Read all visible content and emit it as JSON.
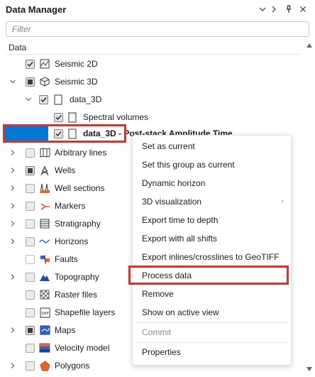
{
  "header": {
    "title": "Data Manager",
    "buttons": [
      "chevron-down-icon",
      "chevron-right-icon",
      "pin-icon",
      "close-icon"
    ]
  },
  "filter": {
    "placeholder": "Filter",
    "value": ""
  },
  "column_header": "Data",
  "tree": {
    "seismic_2d": {
      "label": "Seismic 2D",
      "checked": true
    },
    "seismic_3d": {
      "label": "Seismic 3D",
      "state": "partial"
    },
    "data_3d": {
      "label": "data_3D",
      "checked": true
    },
    "spectral_volumes": {
      "label": "Spectral volumes",
      "checked": true
    },
    "data_3d_post": {
      "label": "data_3D - Post-stack Amplitude Time",
      "checked": true,
      "selected": true
    },
    "arbitrary_lines": {
      "label": "Arbitrary lines"
    },
    "wells": {
      "label": "Wells",
      "state": "partial"
    },
    "well_sections": {
      "label": "Well sections"
    },
    "markers": {
      "label": "Markers"
    },
    "stratigraphy": {
      "label": "Stratigraphy"
    },
    "horizons": {
      "label": "Horizons"
    },
    "faults": {
      "label": "Faults"
    },
    "topography": {
      "label": "Topography"
    },
    "raster_files": {
      "label": "Raster files"
    },
    "shapefile_layers": {
      "label": "Shapefile layers"
    },
    "maps": {
      "label": "Maps",
      "state": "partial"
    },
    "velocity_model": {
      "label": "Velocity model"
    },
    "polygons": {
      "label": "Polygons"
    }
  },
  "context_menu": {
    "set_as_current": "Set as current",
    "set_group_current": "Set this group as current",
    "dynamic_horizon": "Dynamic horizon",
    "visualization_3d": "3D visualization",
    "export_time_depth": "Export time to depth",
    "export_all_shifts": "Export with all shifts",
    "export_geotiff": "Export inlines/crosslines to GeoTIFF",
    "process_data": "Process data",
    "remove": "Remove",
    "show_active_view": "Show on active view",
    "commit": "Commit",
    "properties": "Properties"
  },
  "colors": {
    "selection": "#0078d7",
    "highlight": "#d9312c"
  }
}
